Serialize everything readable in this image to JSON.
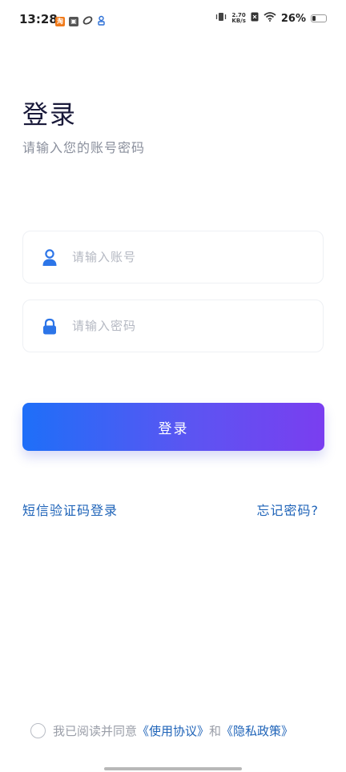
{
  "status_bar": {
    "time": "13:28",
    "net_speed_value": "2.70",
    "net_speed_unit": "KB/s",
    "battery": "26%",
    "battery_level": 0.26
  },
  "header": {
    "title": "登录",
    "subtitle": "请输入您的账号密码"
  },
  "form": {
    "account_placeholder": "请输入账号",
    "account_value": "",
    "password_placeholder": "请输入密码",
    "password_value": "",
    "login_label": "登录"
  },
  "links": {
    "sms_login": "短信验证码登录",
    "forgot_password": "忘记密码?"
  },
  "agreement": {
    "prefix": "我已阅读并同意",
    "terms": "《使用协议》",
    "joiner": "和",
    "privacy": "《隐私政策》"
  },
  "colors": {
    "accent_blue": "#1e6ff8",
    "accent_purple": "#7a3ef0",
    "link": "#1e63b8"
  },
  "icons": {
    "account": "user-icon",
    "password": "lock-icon"
  }
}
